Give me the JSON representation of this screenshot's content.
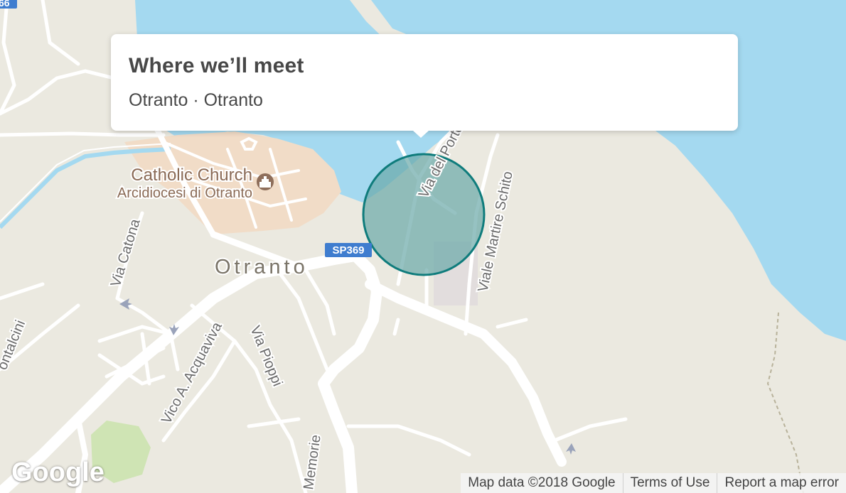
{
  "card": {
    "title": "Where we’ll meet",
    "subtitle": "Otranto · Otranto"
  },
  "map": {
    "labels": {
      "catholic_church": "Catholic Church",
      "arcidiocesi": "Arcidiocesi di Otranto",
      "town": "Otranto",
      "via_del_porto": "Via del Porto",
      "viale_martire_schito": "Viale Martire Schito",
      "via_catona": "Via Catona",
      "vico_acquaviva": "Vico A. Acquaviva",
      "via_pioppi": "Via Pioppi",
      "memorie": "Memorie",
      "montalcini": "ontalcini",
      "road_shield": "SP369",
      "edge_shield": "66"
    },
    "icons": {
      "church": "church-icon"
    },
    "colors": {
      "land": "#ebe9e0",
      "water": "#a4d9f0",
      "old_town": "#f1dcc7",
      "roads": "#ffffff",
      "park": "#cfe4b4",
      "marker_fill": "#6aa8a8",
      "marker_stroke": "#0f7c7c",
      "shield": "#3f7dcf"
    }
  },
  "footer": {
    "google_logo": "Google",
    "map_data": "Map data ©2018 Google",
    "terms": "Terms of Use",
    "report": "Report a map error"
  }
}
